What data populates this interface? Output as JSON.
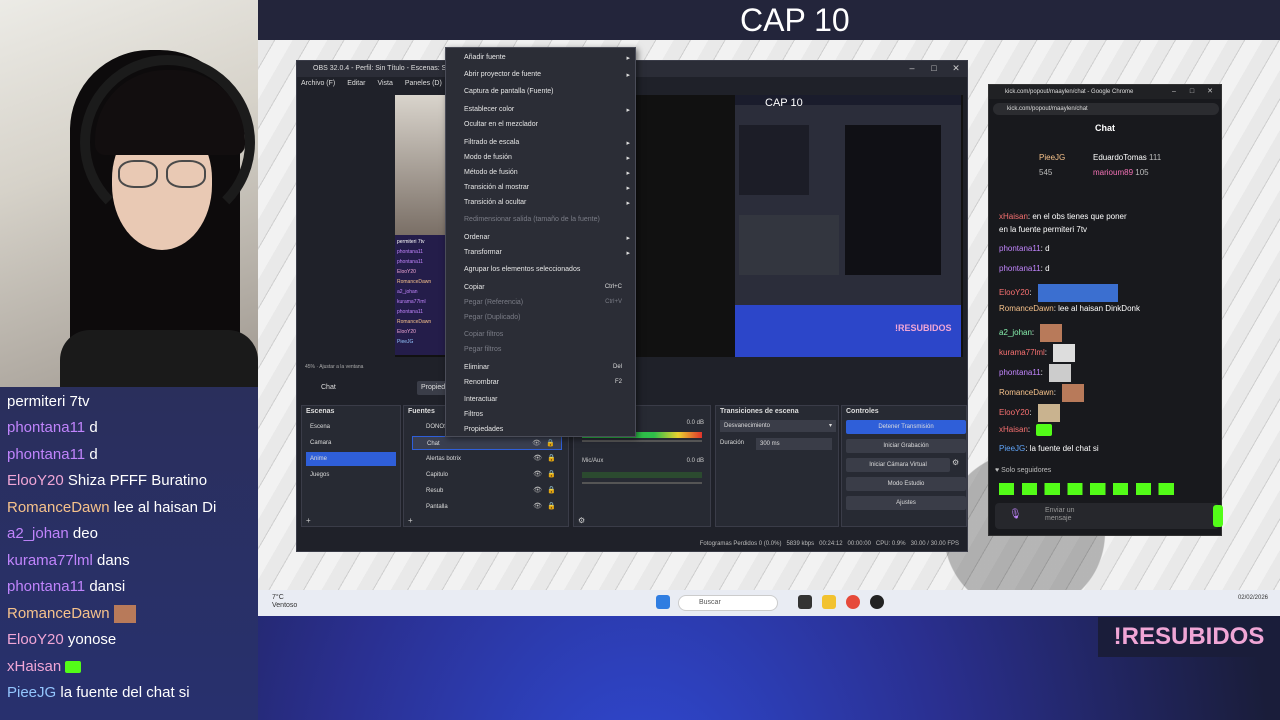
{
  "overlay": {
    "cap_title": "CAP 10",
    "resubidos": "!RESUBIDOS"
  },
  "stream_chat": [
    {
      "user": "",
      "text": "permiteri 7tv"
    },
    {
      "user": "phontana11",
      "text": "d"
    },
    {
      "user": "phontana11",
      "text": "d"
    },
    {
      "user": "ElooY20",
      "text": "Shiza PFFF Buratino"
    },
    {
      "user": "RomanceDawn",
      "text": "lee al haisan Di"
    },
    {
      "user": "a2_johan",
      "text": "deo"
    },
    {
      "user": "kurama77lml",
      "text": "dans"
    },
    {
      "user": "phontana11",
      "text": "dansi"
    },
    {
      "user": "RomanceDawn",
      "text": ""
    },
    {
      "user": "ElooY20",
      "text": "yonose"
    },
    {
      "user": "xHaisan",
      "text": ""
    },
    {
      "user": "PieeJG",
      "text": "la fuente del chat si"
    }
  ],
  "obs": {
    "title": "OBS 32.0.4 - Perfil: Sin Título - Escenas: Sin Título",
    "menu": [
      "Archivo (F)",
      "Editar",
      "Vista",
      "Paneles (D)",
      "Perfil",
      "Colección de escenas",
      "Herramientas",
      "Ayuda"
    ],
    "preview_status": "Ajustar a la ventana",
    "preview_zoom": "45%",
    "preview_cap": "CAP 10",
    "preview_resub": "!RESUBIDOS",
    "current_scene": "Chat",
    "prop_button": "Propiedades",
    "docks": {
      "scenes_title": "Escenas",
      "sources_title": "Fuentes",
      "audio_title": "Mezclador de audio",
      "transitions_title": "Transiciones de escena",
      "controls_title": "Controles"
    },
    "scenes": [
      "Escena",
      "Camara",
      "Anime",
      "Juegos"
    ],
    "scenes_selected": 2,
    "sources": [
      "DONOS",
      "Chat",
      "Alertas botrix",
      "Capitulo",
      "Resub",
      "Pantalla"
    ],
    "sources_selected": 1,
    "audio": {
      "level1": "0.0 dB",
      "label2": "Mic/Aux",
      "level2": "0.0 dB"
    },
    "transition": "Desvanecimiento",
    "duration_label": "Duración",
    "duration_value": "300 ms",
    "controls": [
      "Detener Transmisión",
      "Iniciar Grabación",
      "Iniciar Cámara Virtual",
      "Modo Estudio",
      "Ajustes"
    ],
    "statusbar": {
      "frames": "Fotogramas Perdidos 0 (0.0%)",
      "kbps": "5839 kbps",
      "live": "00:24:12",
      "rec": "00:00:00",
      "cpu": "CPU: 0.9%",
      "fps": "30.00 / 30.00 FPS"
    }
  },
  "context_menu": [
    {
      "label": "Añadir fuente",
      "arrow": true
    },
    {
      "label": "Abrir proyector de fuente",
      "arrow": true
    },
    {
      "label": "Captura de pantalla (Fuente)"
    },
    {
      "label": "Establecer color",
      "arrow": true
    },
    {
      "label": "Ocultar en el mezclador"
    },
    {
      "label": "Filtrado de escala",
      "arrow": true
    },
    {
      "label": "Modo de fusión",
      "arrow": true
    },
    {
      "label": "Método de fusión",
      "arrow": true
    },
    {
      "label": "Transición al mostrar",
      "arrow": true
    },
    {
      "label": "Transición al ocultar",
      "arrow": true
    },
    {
      "label": "Redimensionar salida (tamaño de la fuente)",
      "disabled": true
    },
    {
      "label": "Ordenar",
      "arrow": true
    },
    {
      "label": "Transformar",
      "arrow": true
    },
    {
      "label": "Agrupar los elementos seleccionados"
    },
    {
      "label": "Copiar",
      "shortcut": "Ctrl+C"
    },
    {
      "label": "Pegar (Referencia)",
      "shortcut": "Ctrl+V",
      "disabled": true
    },
    {
      "label": "Pegar (Duplicado)",
      "disabled": true
    },
    {
      "label": "Copiar filtros",
      "disabled": true
    },
    {
      "label": "Pegar filtros",
      "disabled": true
    },
    {
      "label": "Eliminar",
      "shortcut": "Del"
    },
    {
      "label": "Renombrar",
      "shortcut": "F2"
    },
    {
      "label": "Interactuar"
    },
    {
      "label": "Filtros"
    },
    {
      "label": "Propiedades"
    }
  ],
  "chrome": {
    "title": "kick.com/popout/maaylen/chat - Google Chrome",
    "url": "kick.com/popout/maaylen/chat",
    "chat_title": "Chat",
    "leaderboard": [
      {
        "name": "PieeJG",
        "value": ""
      },
      {
        "name": "EduardoTomas",
        "value": "111"
      },
      {
        "name": "",
        "value": "545"
      },
      {
        "name": "marioum89",
        "value": "105"
      }
    ],
    "messages": [
      {
        "user": "xHaisan",
        "text": "en el obs tienes que poner"
      },
      {
        "user": "",
        "text": "en la fuente permiteri 7tv"
      },
      {
        "user": "phontana11",
        "text": "d"
      },
      {
        "user": "phontana11",
        "text": "d"
      },
      {
        "user": "ElooY20",
        "text": ""
      },
      {
        "user": "RomanceDawn",
        "text": "lee al haisan DinkDonk"
      },
      {
        "user": "a2_johan",
        "text": ""
      },
      {
        "user": "kurama77lml",
        "text": ""
      },
      {
        "user": "phontana11",
        "text": ""
      },
      {
        "user": "RomanceDawn",
        "text": ""
      },
      {
        "user": "ElooY20",
        "text": ""
      },
      {
        "user": "xHaisan",
        "text": ""
      },
      {
        "user": "PieeJG",
        "text": "la fuente del chat si"
      }
    ],
    "followers_only": "Solo seguidores",
    "input_placeholder": "Enviar un mensaje"
  },
  "taskbar": {
    "weather_temp": "7°C",
    "weather_desc": "Ventoso",
    "search": "Buscar",
    "date": "02/02/2026"
  },
  "colors": {
    "accent": "#2f5fd9",
    "kick_green": "#53fc18",
    "resub_pink": "#f0a6d6"
  }
}
